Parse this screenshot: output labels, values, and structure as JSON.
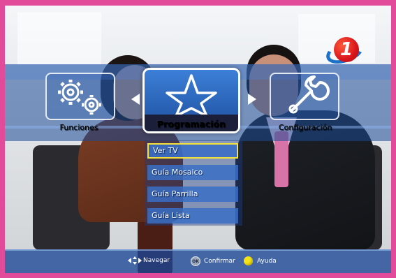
{
  "channel_logo": {
    "text": "1",
    "brand_color": "#d8141a",
    "swoosh_color": "#1a73c8"
  },
  "main_menu": {
    "items": [
      {
        "label": "Funciones",
        "icon": "gears-icon",
        "selected": false
      },
      {
        "label": "Programación",
        "icon": "star-icon",
        "selected": true
      },
      {
        "label": "Configuración",
        "icon": "wrench-icon",
        "selected": false
      }
    ]
  },
  "submenu": {
    "items": [
      {
        "label": "Ver TV",
        "selected": true
      },
      {
        "label": "Guía Mosaico",
        "selected": false
      },
      {
        "label": "Guía Parrilla",
        "selected": false
      },
      {
        "label": "Guía Lista",
        "selected": false
      }
    ]
  },
  "footer": {
    "navigate_label": "Navegar",
    "ok_key": "OK",
    "confirm_label": "Confirmar",
    "help_label": "Ayuda"
  },
  "colors": {
    "frame": "#e24a9a",
    "menu_blue": "#1d4f9e",
    "selection": "#f5e23a",
    "help_key": "#f5e31a"
  }
}
